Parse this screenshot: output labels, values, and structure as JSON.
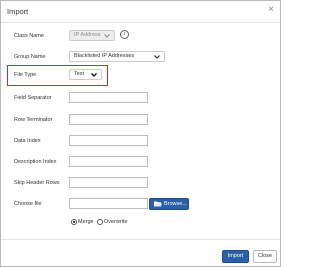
{
  "dialog": {
    "title": "Import",
    "close_icon": "close-icon"
  },
  "form": {
    "class_name": {
      "label": "Class Name",
      "value": "IP Address"
    },
    "group_name": {
      "label": "Group Name",
      "value": "Blacklisted IP Addresses"
    },
    "file_type": {
      "label": "File Type",
      "value": "Text"
    },
    "field_separator": {
      "label": "Field Separator",
      "value": ""
    },
    "row_terminator": {
      "label": "Row Terminator",
      "value": ""
    },
    "data_index": {
      "label": "Data Index",
      "value": ""
    },
    "description_index": {
      "label": "Description Index",
      "value": ""
    },
    "skip_header_rows": {
      "label": "Skip Header Rows",
      "value": ""
    },
    "choose_file": {
      "label": "Choose file",
      "value": "",
      "browse_label": "Browse..."
    },
    "mode": {
      "options": [
        "Merge",
        "Overwrite"
      ],
      "selected": "Merge"
    }
  },
  "footer": {
    "import_label": "Import",
    "close_label": "Close"
  },
  "colors": {
    "primary": "#2b5fa6",
    "highlight": "#d9272e"
  },
  "icons": {
    "info": "info-icon",
    "chevron": "chevron-down-icon",
    "folder": "folder-open-icon"
  }
}
